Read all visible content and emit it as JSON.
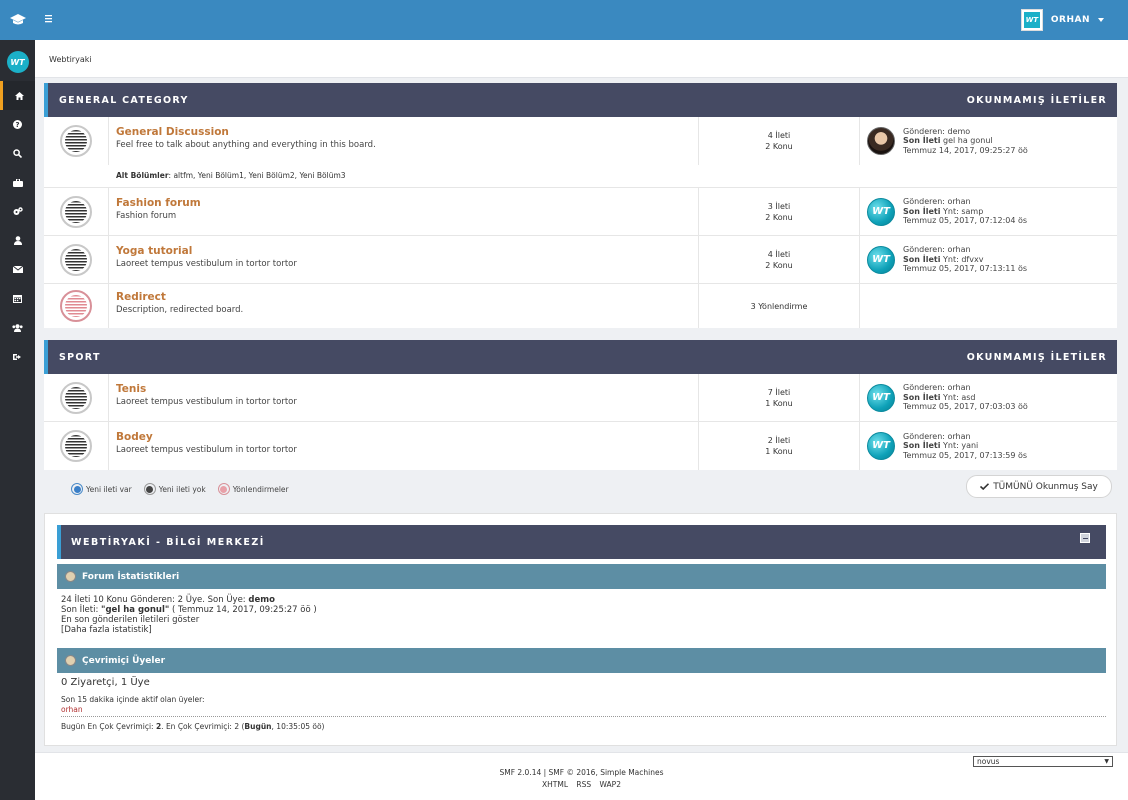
{
  "user": {
    "avatar_text": "WT",
    "name": "ORHAN"
  },
  "sidebar": {
    "logo_text": "WT",
    "items": [
      {
        "icon": "home-icon"
      },
      {
        "icon": "help-icon"
      },
      {
        "icon": "search-icon"
      },
      {
        "icon": "briefcase-icon"
      },
      {
        "icon": "gears-icon"
      },
      {
        "icon": "user-icon"
      },
      {
        "icon": "envelope-icon"
      },
      {
        "icon": "calendar-icon"
      },
      {
        "icon": "users-icon"
      },
      {
        "icon": "logout-icon"
      }
    ]
  },
  "breadcrumb": "Webtiryaki",
  "categories": [
    {
      "name": "GENERAL CATEGORY",
      "unread_label": "OKUNMAMIŞ İLETİLER",
      "boards": [
        {
          "title": "General Discussion",
          "desc": "Feel free to talk about anything and everything in this board.",
          "stats1": "4 İleti",
          "stats2": "2 Konu",
          "last_by": "Gönderen: demo",
          "last_label": "Son İleti",
          "last_topic": " gel ha gonul",
          "last_date": "Temmuz 14, 2017, 09:25:27 öö",
          "subboards_label": "Alt Bölümler",
          "subboards": ": altfm, Yeni Bölüm1, Yeni Bölüm2, Yeni Bölüm3"
        },
        {
          "title": "Fashion forum",
          "desc": "Fashion forum",
          "stats1": "3 İleti",
          "stats2": "2 Konu",
          "last_by": "Gönderen: orhan",
          "last_label": "Son İleti",
          "last_topic": " Ynt: samp",
          "last_date": "Temmuz 05, 2017, 07:12:04 ös"
        },
        {
          "title": "Yoga tutorial",
          "desc": "Laoreet tempus vestibulum in tortor tortor",
          "stats1": "4 İleti",
          "stats2": "2 Konu",
          "last_by": "Gönderen: orhan",
          "last_label": "Son İleti",
          "last_topic": " Ynt: dfvxv",
          "last_date": "Temmuz 05, 2017, 07:13:11 ös"
        },
        {
          "title": "Redirect",
          "desc": "Description, redirected board.",
          "stats1": "3 Yönlendirme"
        }
      ]
    },
    {
      "name": "SPORT",
      "unread_label": "OKUNMAMIŞ İLETİLER",
      "boards": [
        {
          "title": "Tenis",
          "desc": "Laoreet tempus vestibulum in tortor tortor",
          "stats1": "7 İleti",
          "stats2": "1 Konu",
          "last_by": "Gönderen: orhan",
          "last_label": "Son İleti",
          "last_topic": " Ynt: asd",
          "last_date": "Temmuz 05, 2017, 07:03:03 öö"
        },
        {
          "title": "Bodey",
          "desc": "Laoreet tempus vestibulum in tortor tortor",
          "stats1": "2 İleti",
          "stats2": "1 Konu",
          "last_by": "Gönderen: orhan",
          "last_label": "Son İleti",
          "last_topic": " Ynt: yani",
          "last_date": "Temmuz 05, 2017, 07:13:59 ös"
        }
      ]
    }
  ],
  "legend": {
    "new": "Yeni ileti var",
    "nonew": "Yeni ileti yok",
    "redirect": "Yönlendirmeler"
  },
  "mark_read": "TÜMÜNÜ Okunmuş Say",
  "info_center": {
    "title": "WEBTİRYAKİ - BİLGİ MERKEZİ",
    "stats_title": "Forum İstatistikleri",
    "stats_line1": "24 İleti 10 Konu Gönderen: 2 Üye. Son Üye: ",
    "stats_latest_member": "demo",
    "stats_line2a": "Son İleti: ",
    "stats_line2b": "\"gel ha gonul\"",
    "stats_line2c": " ( Temmuz 14, 2017, 09:25:27 öö )",
    "stats_line3": "En son gönderilen iletileri göster",
    "stats_line4": "[Daha fazla istatistik]",
    "online_title": "Çevrimiçi Üyeler",
    "online_count": "0 Ziyaretçi, 1 Üye",
    "online_desc": "Son 15 dakika içinde aktif olan üyeler:",
    "online_user": "orhan",
    "record_a": "Bugün En Çok Çevrimiçi: ",
    "record_b": "2",
    "record_c": ". En Çok Çevrimiçi: 2 (",
    "record_d": "Bugün",
    "record_e": ", 10:35:05 öö)"
  },
  "footer": {
    "credit": "SMF 2.0.14 | SMF © 2016, Simple Machines",
    "xhtml": "XHTML",
    "rss": "RSS",
    "wap2": "WAP2",
    "theme": "novus"
  },
  "colors": {
    "topbar": "#3a89c0",
    "sidebar": "#2a2d33",
    "cat_header": "#454a63",
    "accent": "#3a9fd5",
    "board_title": "#c0783a",
    "info_sub": "#5d8ea4"
  }
}
